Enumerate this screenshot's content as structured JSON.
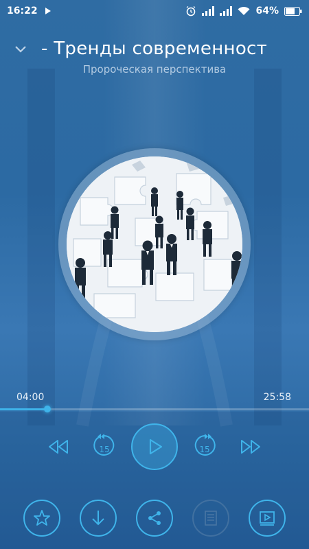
{
  "status_bar": {
    "time": "16:22",
    "battery": "64%"
  },
  "header": {
    "title": "- Тренды современност",
    "subtitle": "Пророческая перспектива"
  },
  "player": {
    "current_time": "04:00",
    "total_time": "25:58",
    "progress_fraction": 0.154,
    "skip_back_seconds": "15",
    "skip_forward_seconds": "15"
  },
  "colors": {
    "accent": "#3fb4ea",
    "background": "#2f6ca3"
  },
  "icons": {
    "collapse": "chevron-down-icon",
    "rewind": "rewind-icon",
    "back15": "replay-15-icon",
    "play": "play-icon",
    "forward15": "forward-15-icon",
    "fastforward": "fast-forward-icon",
    "favorite": "star-icon",
    "download": "download-icon",
    "share": "share-icon",
    "text": "document-icon",
    "video": "video-icon"
  }
}
